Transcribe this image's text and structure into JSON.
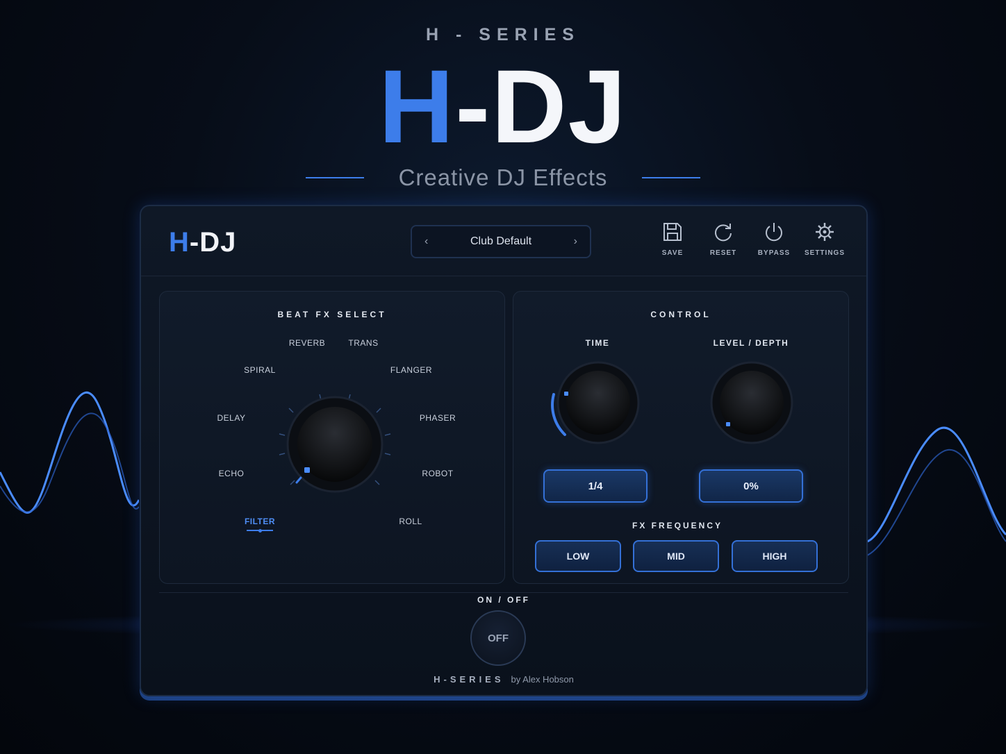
{
  "hero": {
    "series": "H - SERIES",
    "title_h": "H",
    "title_rest": "-DJ",
    "tagline": "Creative DJ Effects"
  },
  "header": {
    "logo_h": "H",
    "logo_rest": "-DJ",
    "preset": {
      "name": "Club Default",
      "prev": "‹",
      "next": "›"
    },
    "tools": [
      {
        "label": "SAVE",
        "icon": "save-icon"
      },
      {
        "label": "RESET",
        "icon": "reset-icon"
      },
      {
        "label": "BYPASS",
        "icon": "power-icon"
      },
      {
        "label": "SETTINGS",
        "icon": "gear-icon"
      }
    ]
  },
  "beat_fx": {
    "title": "BEAT FX SELECT",
    "effects": {
      "reverb": "REVERB",
      "trans": "TRANS",
      "spiral": "SPIRAL",
      "flanger": "FLANGER",
      "delay": "DELAY",
      "phaser": "PHASER",
      "echo": "ECHO",
      "robot": "ROBOT",
      "filter": "FILTER",
      "roll": "ROLL"
    },
    "selected": "FILTER"
  },
  "control": {
    "title": "CONTROL",
    "time": {
      "label": "TIME",
      "value": "1/4"
    },
    "level": {
      "label": "LEVEL / DEPTH",
      "value": "0%"
    },
    "fx_frequency": {
      "label": "FX FREQUENCY",
      "options": [
        "LOW",
        "MID",
        "HIGH"
      ]
    }
  },
  "power": {
    "label": "ON / OFF",
    "state": "OFF"
  },
  "footer": {
    "brand": "H-SERIES",
    "author": "by Alex Hobson"
  },
  "colors": {
    "accent": "#3d7dea",
    "background": "#070d18",
    "panel": "#0f1826"
  }
}
